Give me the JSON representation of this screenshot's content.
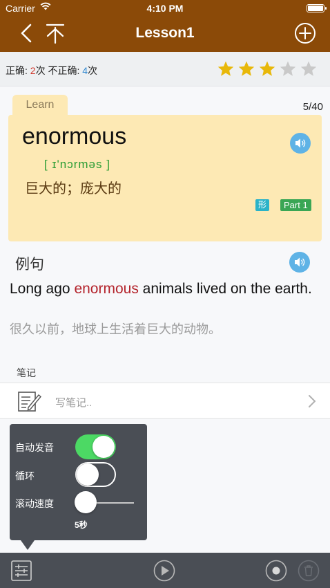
{
  "status_bar": {
    "carrier": "Carrier",
    "time": "4:10 PM"
  },
  "nav": {
    "title": "Lesson1"
  },
  "stats": {
    "correct_label": "正确: ",
    "correct_count": "2",
    "correct_unit": "次 ",
    "incorrect_label": "不正确: ",
    "incorrect_count": "4",
    "incorrect_unit": "次",
    "rating": 3,
    "rating_max": 5
  },
  "card": {
    "tab_label": "Learn",
    "progress": "5/40",
    "word": "enormous",
    "phonetic": "[ ɪ'nɔrməs ]",
    "meaning": "巨大的；庞大的",
    "pos_badge": "形",
    "part_badge": "Part 1"
  },
  "example": {
    "heading": "例句",
    "en_before": "Long ago ",
    "en_highlight": "enormous",
    "en_after": " animals lived on the earth.",
    "zh": "很久以前，地球上生活着巨大的动物。"
  },
  "notes": {
    "label": "笔记",
    "placeholder": "写笔记.."
  },
  "panel": {
    "auto_pronounce_label": "自动发音",
    "auto_pronounce_on": true,
    "loop_label": "循环",
    "loop_on": false,
    "scroll_speed_label": "滚动速度",
    "scroll_speed_value": "5秒"
  },
  "colors": {
    "nav_bg": "#8b4a08",
    "card_bg": "#fde9b4",
    "toggle_on": "#4cd964",
    "panel_bg": "#4a4e55",
    "star_on": "#e8b80a",
    "star_off": "#c9c9c9",
    "speaker": "#5fb3e6"
  },
  "icons": {
    "back": "chevron-left-icon",
    "download": "arrow-down-icon",
    "add": "plus-circle-icon",
    "speaker": "speaker-icon",
    "note": "note-pencil-icon",
    "settings": "sliders-icon",
    "play": "play-icon",
    "record": "record-icon",
    "delete": "trash-icon"
  }
}
